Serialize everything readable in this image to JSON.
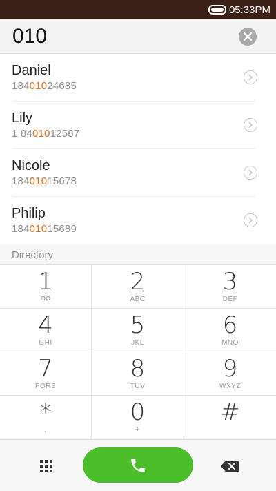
{
  "status_bar": {
    "time": "05:33PM"
  },
  "dialer": {
    "number": "010"
  },
  "contacts": [
    {
      "name": "Daniel",
      "phone_prefix": "184",
      "phone_match": "010",
      "phone_suffix": "24685"
    },
    {
      "name": "Lily",
      "phone_prefix": "1 84",
      "phone_match": "010",
      "phone_suffix": "12587"
    },
    {
      "name": "Nicole",
      "phone_prefix": "184",
      "phone_match": "010",
      "phone_suffix": "15678"
    },
    {
      "name": "Philip",
      "phone_prefix": "184",
      "phone_match": "010",
      "phone_suffix": "15689"
    }
  ],
  "directory_label": "Directory",
  "keypad": [
    {
      "digit": "1",
      "letters": ""
    },
    {
      "digit": "2",
      "letters": "ABC"
    },
    {
      "digit": "3",
      "letters": "DEF"
    },
    {
      "digit": "4",
      "letters": "GHI"
    },
    {
      "digit": "5",
      "letters": "JKL"
    },
    {
      "digit": "6",
      "letters": "MNO"
    },
    {
      "digit": "7",
      "letters": "PQRS"
    },
    {
      "digit": "8",
      "letters": "TUV"
    },
    {
      "digit": "9",
      "letters": "WXYZ"
    },
    {
      "digit": "*",
      "letters": ","
    },
    {
      "digit": "0",
      "letters": "+"
    },
    {
      "digit": "#",
      "letters": ""
    }
  ],
  "colors": {
    "highlight": "#e96a18",
    "call_button": "#4bbd2a",
    "status_bar": "#3a1f17"
  }
}
